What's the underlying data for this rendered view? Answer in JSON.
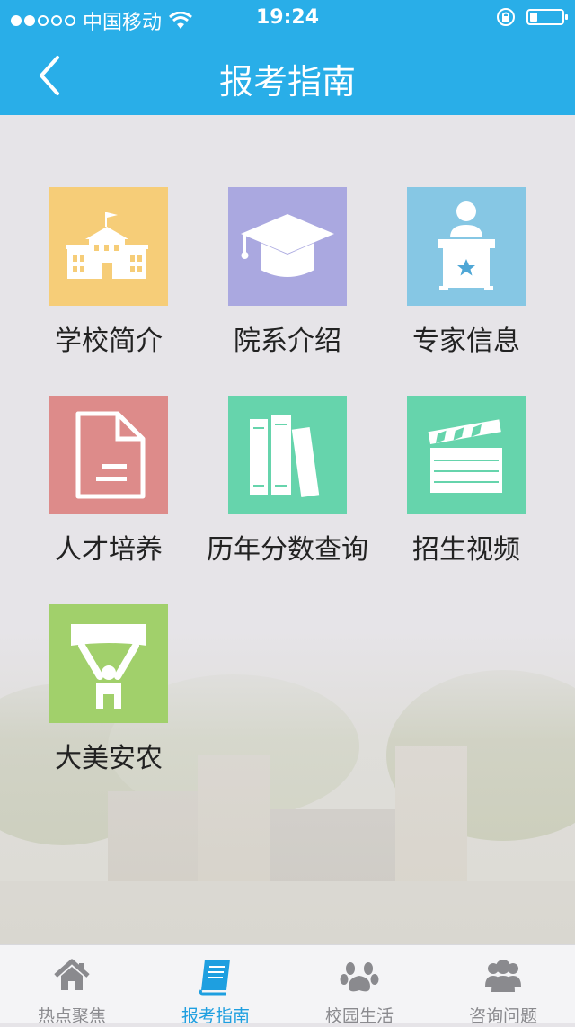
{
  "status": {
    "carrier": "中国移动",
    "time": "19:24"
  },
  "nav": {
    "title": "报考指南"
  },
  "grid": {
    "items": [
      {
        "label": "学校简介",
        "icon": "school-building-icon",
        "color": "#f6cd78"
      },
      {
        "label": "院系介绍",
        "icon": "graduation-cap-icon",
        "color": "#aaa8e0"
      },
      {
        "label": "专家信息",
        "icon": "speaker-podium-icon",
        "color": "#86c7e4"
      },
      {
        "label": "人才培养",
        "icon": "document-icon",
        "color": "#dd8b8a"
      },
      {
        "label": "历年分数查询",
        "icon": "books-icon",
        "color": "#66d4ac"
      },
      {
        "label": "招生视频",
        "icon": "clapperboard-icon",
        "color": "#66d4ac"
      },
      {
        "label": "大美安农",
        "icon": "banner-person-icon",
        "color": "#a1d06b"
      }
    ]
  },
  "tabs": [
    {
      "label": "热点聚焦",
      "icon": "home-icon",
      "active": false
    },
    {
      "label": "报考指南",
      "icon": "book-icon",
      "active": true
    },
    {
      "label": "校园生活",
      "icon": "paw-icon",
      "active": false
    },
    {
      "label": "咨询问题",
      "icon": "users-icon",
      "active": false
    }
  ],
  "colors": {
    "header": "#29aee8",
    "tab_active": "#1e9fe0",
    "tab_inactive": "#8a8a8e"
  }
}
